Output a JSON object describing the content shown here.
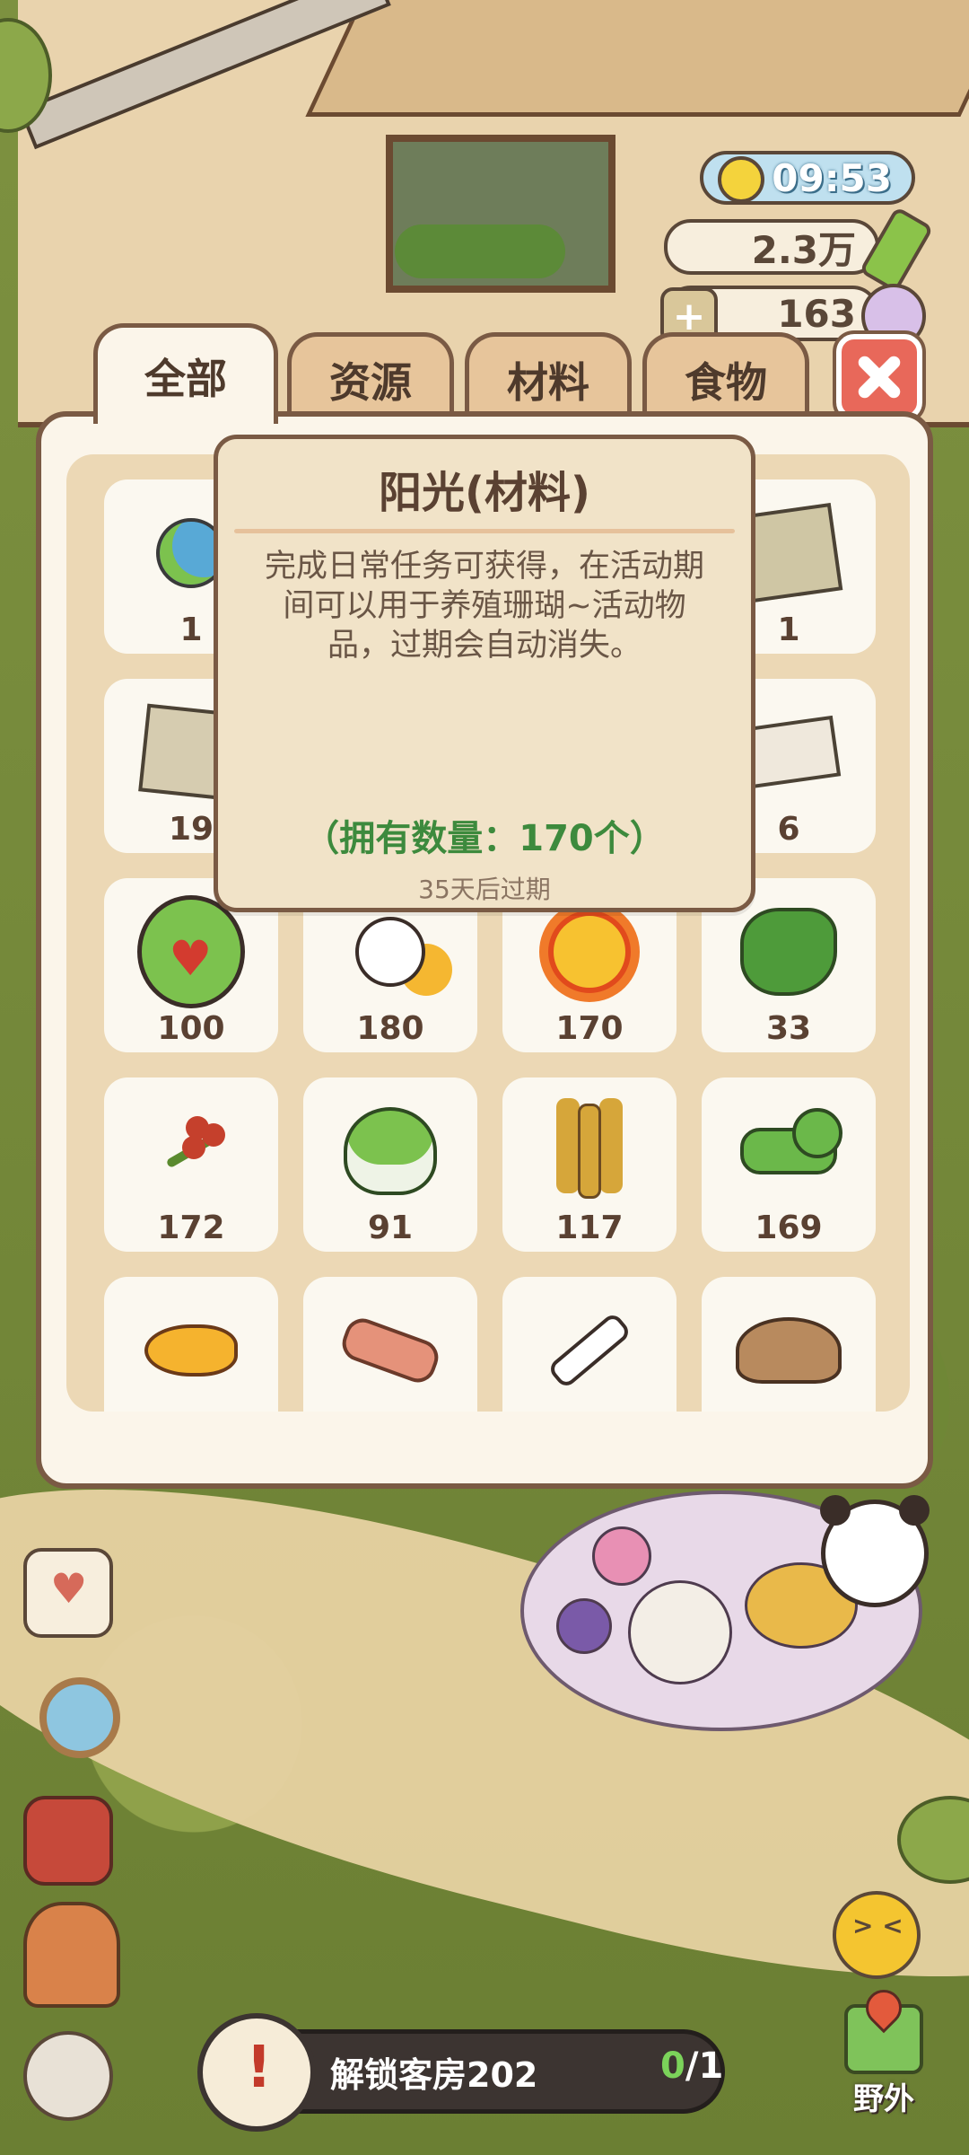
{
  "hud": {
    "time": "09:53",
    "coins": "2.3万",
    "gems": "163"
  },
  "tabs": {
    "all": "全部",
    "resources": "资源",
    "materials": "材料",
    "food": "食物"
  },
  "inventory": {
    "slots": [
      {
        "icon": "globe-icon",
        "count": "1"
      },
      {
        "icon": "unknown-item-icon",
        "count": ""
      },
      {
        "icon": "unknown-item-icon",
        "count": ""
      },
      {
        "icon": "map-icon",
        "count": "1"
      },
      {
        "icon": "paper-scrap-icon",
        "count": "19"
      },
      {
        "icon": "unknown-item-icon",
        "count": ""
      },
      {
        "icon": "unknown-item-icon",
        "count": ""
      },
      {
        "icon": "cloth-scrap-icon",
        "count": "6"
      },
      {
        "icon": "panda-heart-badge-icon",
        "count": "100"
      },
      {
        "icon": "egg-creature-icon",
        "count": "180"
      },
      {
        "icon": "sunshine-icon",
        "count": "170"
      },
      {
        "icon": "coral-icon",
        "count": "33"
      },
      {
        "icon": "berry-branch-icon",
        "count": "172"
      },
      {
        "icon": "bok-choy-icon",
        "count": "91"
      },
      {
        "icon": "wheat-icon",
        "count": "117"
      },
      {
        "icon": "caterpillar-icon",
        "count": "169"
      },
      {
        "icon": "fish-icon",
        "count": ""
      },
      {
        "icon": "bacon-icon",
        "count": ""
      },
      {
        "icon": "bone-icon",
        "count": ""
      },
      {
        "icon": "mushroom-icon",
        "count": ""
      }
    ]
  },
  "tooltip": {
    "title": "阳光(材料)",
    "description": "完成日常任务可获得，在活动期间可以用于养殖珊瑚~活动物品，过期会自动消失。",
    "owned": "（拥有数量：170个）",
    "expiry": "35天后过期"
  },
  "quest": {
    "label": "解锁客房202",
    "done": "0",
    "total": "/1"
  },
  "outdoor": {
    "label": "野外"
  },
  "colors": {
    "panel_border": "#7a5a44",
    "owned_green": "#3d8a3d",
    "close_red": "#e8685a"
  }
}
